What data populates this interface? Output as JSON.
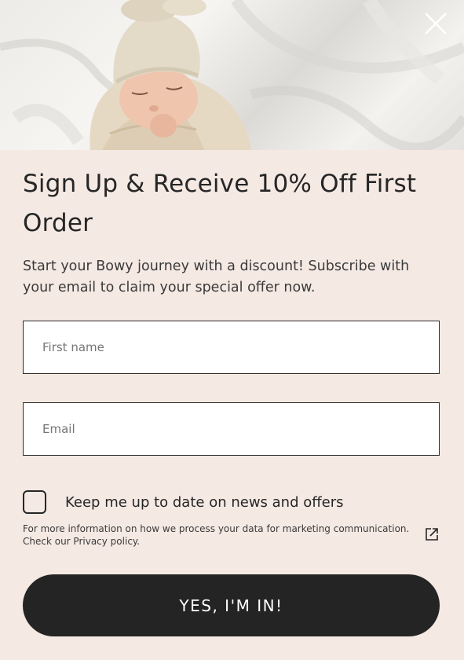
{
  "hero": {
    "image_alt": "Newborn baby in cream knotted hat swaddled on white sheets"
  },
  "close": {
    "icon": "close-icon"
  },
  "title": "Sign Up & Receive 10% Off First Order",
  "subtitle": "Start your Bowy journey with a discount! Subscribe with your email to claim your special offer now.",
  "form": {
    "first_name": {
      "placeholder": "First name",
      "value": ""
    },
    "email": {
      "placeholder": "Email",
      "value": ""
    }
  },
  "consent": {
    "label": "Keep me up to date on news and offers",
    "checked": false
  },
  "privacy": {
    "text": "For more information on how we process your data for marketing communication. Check our Privacy policy.",
    "icon": "external-link-icon"
  },
  "submit_label": "YES, I'M IN!",
  "colors": {
    "background": "#f5e9e3",
    "button": "#242424",
    "text": "#262626"
  }
}
